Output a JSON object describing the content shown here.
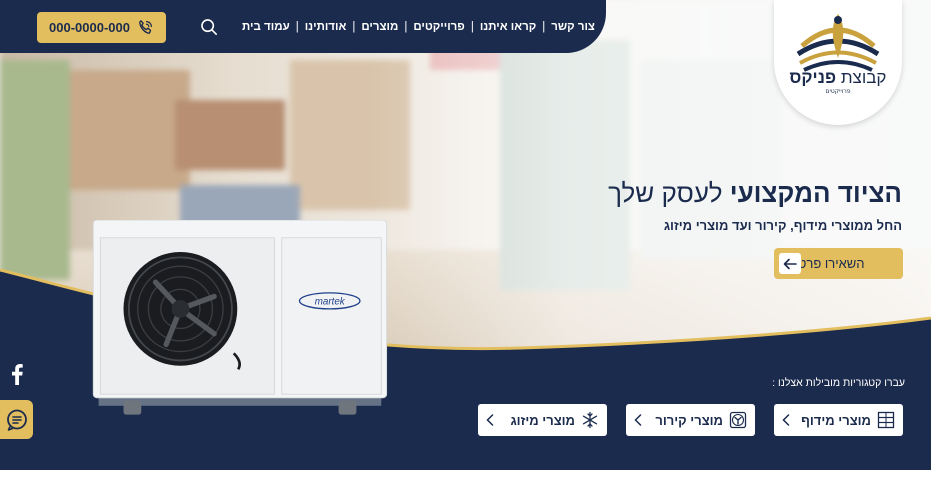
{
  "header": {
    "phone": "000-0000-000",
    "nav": [
      "עמוד בית",
      "אודותינו",
      "מוצרים",
      "פרוייקטים",
      "קראו איתנו",
      "צור קשר"
    ]
  },
  "logo": {
    "prefix": "קבוצת",
    "name": "פניקס",
    "sub": "פרוייקטים"
  },
  "hero": {
    "title_bold": "הציוד המקצועי",
    "title_light": "לעסק שלך",
    "subtitle": "החל ממוצרי מידוף, קירור ועד מוצרי מיזוג",
    "cta": "השאירו פרטים"
  },
  "unit": {
    "brand": "martek"
  },
  "categories": {
    "caption": "עברו קטגוריות מובילות אצלנו :",
    "items": [
      {
        "label": "מוצרי מידוף",
        "icon": "shelf-icon"
      },
      {
        "label": "מוצרי קירור",
        "icon": "fan-icon"
      },
      {
        "label": "מוצרי מיזוג",
        "icon": "snowflake-icon"
      }
    ]
  },
  "social": {
    "facebook": "facebook-icon",
    "chat": "chat-icon"
  },
  "colors": {
    "navy": "#1b2b4d",
    "gold": "#e3be5f",
    "white": "#ffffff"
  }
}
